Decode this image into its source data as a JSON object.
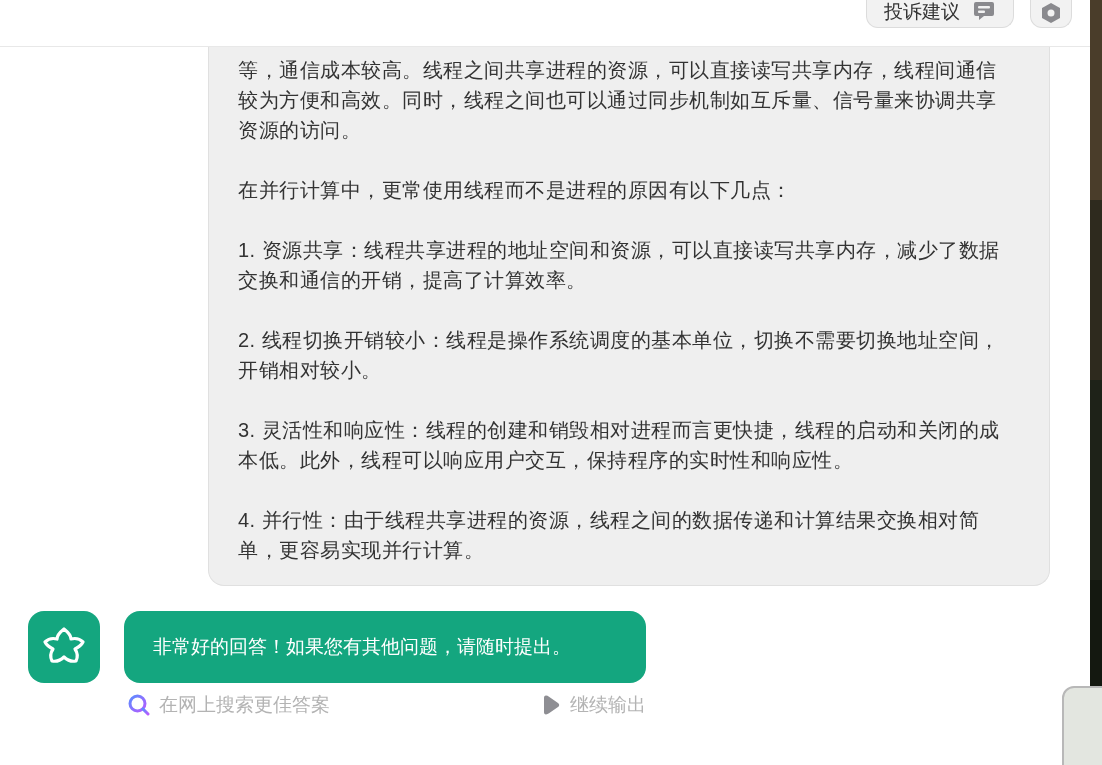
{
  "header": {
    "buttons": [
      {
        "kind": "feedback",
        "label": "投诉建议"
      },
      {
        "kind": "settings"
      }
    ]
  },
  "answer": {
    "paragraphs": [
      "等，通信成本较高。线程之间共享进程的资源，可以直接读写共享内存，线程间通信较为方便和高效。同时，线程之间也可以通过同步机制如互斥量、信号量来协调共享资源的访问。",
      "在并行计算中，更常使用线程而不是进程的原因有以下几点：",
      "1. 资源共享：线程共享进程的地址空间和资源，可以直接读写共享内存，减少了数据交换和通信的开销，提高了计算效率。",
      "2. 线程切换开销较小：线程是操作系统调度的基本单位，切换不需要切换地址空间，开销相对较小。",
      "3. 灵活性和响应性：线程的创建和销毁相对进程而言更快捷，线程的启动和关闭的成本低。此外，线程可以响应用户交互，保持程序的实时性和响应性。",
      "4. 并行性：由于线程共享进程的资源，线程之间的数据传递和计算结果交换相对简单，更容易实现并行计算。"
    ]
  },
  "reply": {
    "text": "非常好的回答！如果您有其他问题，请随时提出。"
  },
  "actions": [
    {
      "kind": "search",
      "label": "在网上搜索更佳答案"
    },
    {
      "kind": "continue",
      "label": "继续输出"
    }
  ]
}
